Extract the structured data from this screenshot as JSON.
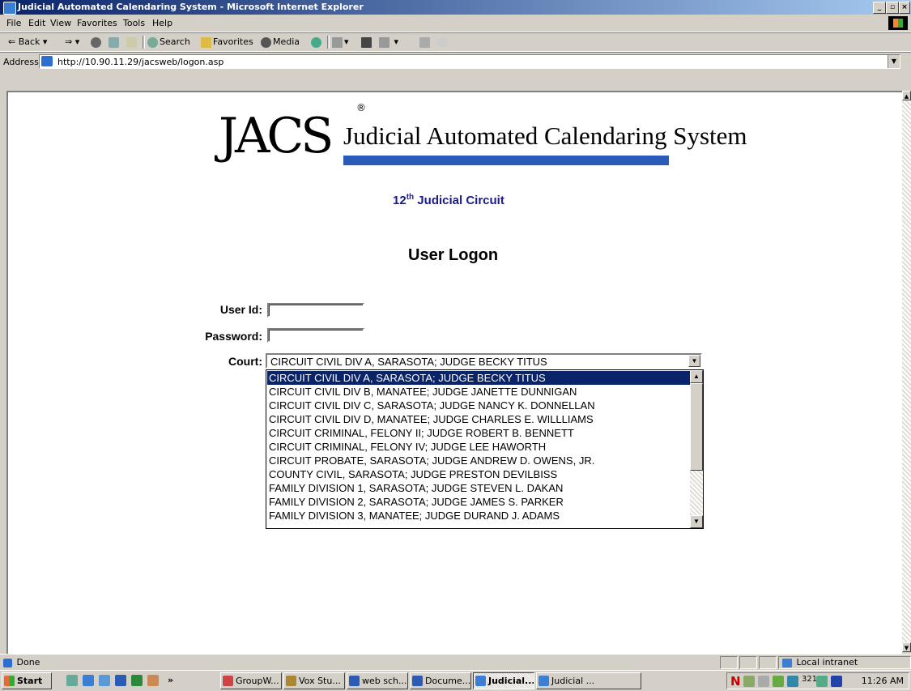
{
  "window": {
    "title": "Judicial Automated Calendaring System - Microsoft Internet Explorer"
  },
  "menu": [
    "File",
    "Edit",
    "View",
    "Favorites",
    "Tools",
    "Help"
  ],
  "toolbar": {
    "back": "Back",
    "search": "Search",
    "favorites": "Favorites",
    "media": "Media"
  },
  "address": {
    "label": "Address",
    "url": "http://10.90.11.29/jacsweb/logon.asp"
  },
  "page": {
    "logo_text": "JACS",
    "logo_reg": "®",
    "logo_subtitle": "Judicial Automated Calendaring System",
    "circuit_num": "12",
    "circuit_sup": "th",
    "circuit_rest": " Judicial Circuit",
    "heading": "User Logon",
    "userid_label": "User Id:",
    "password_label": "Password:",
    "court_label": "Court:",
    "court_selected": "CIRCUIT CIVIL DIV A, SARASOTA; JUDGE BECKY TITUS",
    "court_options": [
      "CIRCUIT CIVIL DIV A, SARASOTA; JUDGE BECKY TITUS",
      "CIRCUIT CIVIL DIV B, MANATEE; JUDGE JANETTE DUNNIGAN",
      "CIRCUIT CIVIL DIV C, SARASOTA; JUDGE NANCY K. DONNELLAN",
      "CIRCUIT CIVIL DIV D, MANATEE; JUDGE CHARLES E. WILLLIAMS",
      "CIRCUIT CRIMINAL, FELONY II; JUDGE ROBERT B. BENNETT",
      "CIRCUIT CRIMINAL, FELONY IV; JUDGE LEE HAWORTH",
      "CIRCUIT PROBATE, SARASOTA; JUDGE ANDREW D. OWENS, JR.",
      "COUNTY CIVIL, SARASOTA; JUDGE PRESTON DEVILBISS",
      "FAMILY DIVISION 1, SARASOTA; JUDGE STEVEN L. DAKAN",
      "FAMILY DIVISION 2, SARASOTA; JUDGE JAMES S. PARKER",
      "FAMILY DIVISION 3, MANATEE; JUDGE DURAND J. ADAMS"
    ],
    "colors": {
      "circuit_text": "#1b1b8c",
      "logo_bar": "#2a5bb8",
      "selection": "#0a246a"
    }
  },
  "status": {
    "text": "Done",
    "zone": "Local intranet"
  },
  "taskbar": {
    "start": "Start",
    "more": "»",
    "buttons": [
      "GroupW...",
      "Vox Stu...",
      "web sch...",
      "Docume...",
      "Judicial...",
      "Judicial ..."
    ],
    "tray_text": "321",
    "clock": "11:26 AM"
  }
}
